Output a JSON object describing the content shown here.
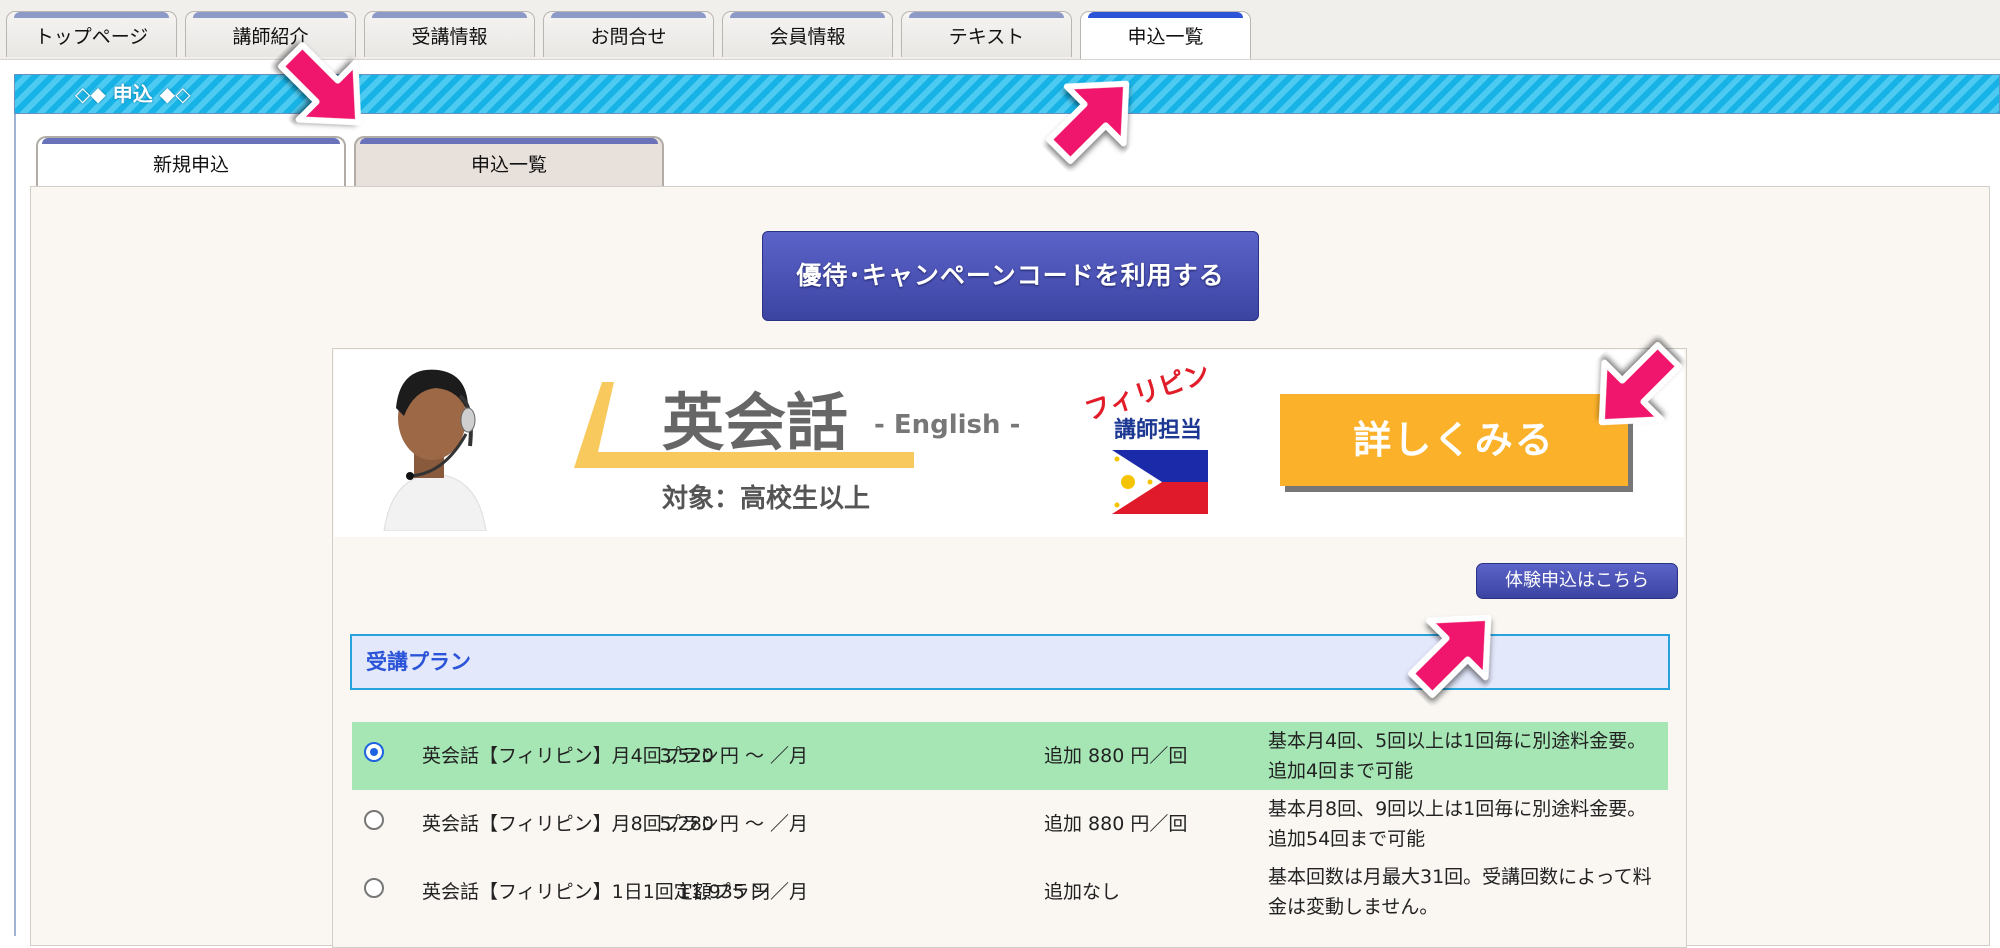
{
  "top_tabs": [
    {
      "label": "トップページ"
    },
    {
      "label": "講師紹介"
    },
    {
      "label": "受講情報"
    },
    {
      "label": "お問合せ"
    },
    {
      "label": "会員情報"
    },
    {
      "label": "テキスト"
    },
    {
      "label": "申込一覧",
      "active": true
    }
  ],
  "section": {
    "title": "◇◆ 申込 ◆◇"
  },
  "sub_tabs": [
    {
      "label": "新規申込",
      "active": true
    },
    {
      "label": "申込一覧"
    }
  ],
  "campaign_button": "優待･キャンペーンコードを利用する",
  "banner": {
    "title": "英会話",
    "subtitle": "- English -",
    "target": "対象：高校生以上",
    "country": "フィリピン",
    "teacher": "講師担当",
    "detail_button": "詳しくみる"
  },
  "trial_button": "体験申込はこちら",
  "plan_header": "受講プラン",
  "plans": [
    {
      "name": "英会話【フィリピン】月4回プラン",
      "price": "3,520 円 〜 ／月",
      "extra": "追加 880 円／回",
      "note": "基本月4回、5回以上は1回毎に別途料金要。追加4回まで可能",
      "selected": true
    },
    {
      "name": "英会話【フィリピン】月8回プラン",
      "price": "5,280 円 〜 ／月",
      "extra": "追加 880 円／回",
      "note": "基本月8回、9回以上は1回毎に別途料金要。追加54回まで可能",
      "selected": false
    },
    {
      "name": "英会話【フィリピン】1日1回定額プラン",
      "price": "11,935 円／月",
      "extra": "追加なし",
      "note": "基本回数は月最大31回。受講回数によって料金は変動しません。",
      "selected": false
    }
  ],
  "colors": {
    "accent_blue": "#3c44a2",
    "header_cyan": "#17b3e6",
    "detail_orange": "#fbb12a",
    "selected_row": "#a6e6b5",
    "arrow_pink": "#f0146e"
  }
}
